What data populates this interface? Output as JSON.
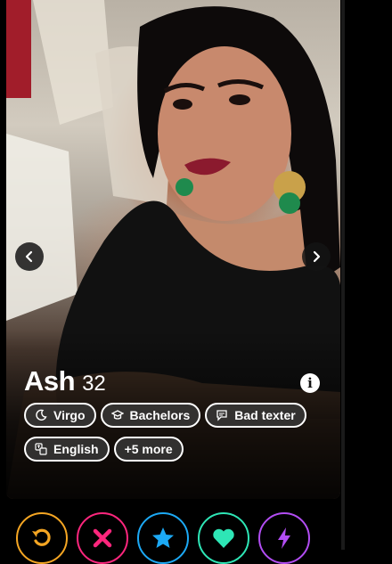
{
  "profile": {
    "name": "Ash",
    "age": "32"
  },
  "chips": [
    {
      "label": "Virgo",
      "icon": "moon-icon"
    },
    {
      "label": "Bachelors",
      "icon": "graduation-cap-icon"
    },
    {
      "label": "Bad texter",
      "icon": "chat-bubble-icon"
    },
    {
      "label": "English",
      "icon": "language-icon"
    },
    {
      "label": "+5 more",
      "icon": ""
    }
  ],
  "actions": [
    {
      "name": "rewind",
      "color": "#f5a623"
    },
    {
      "name": "nope",
      "color": "#fd267d"
    },
    {
      "name": "super-like",
      "color": "#1ca9f5"
    },
    {
      "name": "like",
      "color": "#2ee6b6"
    },
    {
      "name": "boost",
      "color": "#b24df3"
    }
  ]
}
